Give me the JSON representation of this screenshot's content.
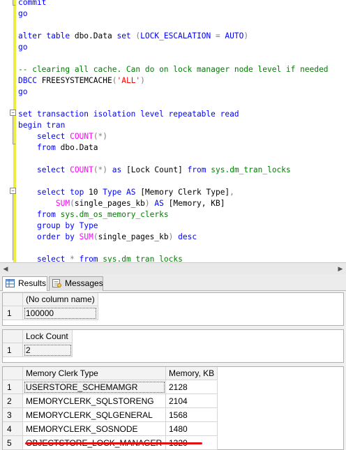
{
  "editor": {
    "lines": [
      {
        "tokens": [
          {
            "t": "commit",
            "c": "kw"
          }
        ]
      },
      {
        "tokens": [
          {
            "t": "go",
            "c": "kw"
          }
        ]
      },
      {
        "tokens": []
      },
      {
        "tokens": [
          {
            "t": "alter table",
            "c": "kw"
          },
          {
            "t": " dbo.Data ",
            "c": "obj"
          },
          {
            "t": "set",
            "c": "kw"
          },
          {
            "t": " (",
            "c": "gry"
          },
          {
            "t": "LOCK_ESCALATION",
            "c": "kw"
          },
          {
            "t": " = ",
            "c": "gry"
          },
          {
            "t": "AUTO",
            "c": "kw"
          },
          {
            "t": ")",
            "c": "gry"
          }
        ]
      },
      {
        "tokens": [
          {
            "t": "go",
            "c": "kw"
          }
        ]
      },
      {
        "tokens": []
      },
      {
        "tokens": [
          {
            "t": "-- clearing all cache. Can do on lock manager node level if needed",
            "c": "cmt"
          }
        ]
      },
      {
        "tokens": [
          {
            "t": "DBCC",
            "c": "kw"
          },
          {
            "t": " FREESYSTEMCACHE",
            "c": "obj"
          },
          {
            "t": "(",
            "c": "gry"
          },
          {
            "t": "'ALL'",
            "c": "str"
          },
          {
            "t": ")",
            "c": "gry"
          }
        ]
      },
      {
        "tokens": [
          {
            "t": "go",
            "c": "kw"
          }
        ]
      },
      {
        "tokens": []
      },
      {
        "tokens": [
          {
            "t": "set transaction isolation level repeatable read",
            "c": "kw"
          }
        ]
      },
      {
        "tokens": [
          {
            "t": "begin tran",
            "c": "kw"
          }
        ]
      },
      {
        "tokens": [
          {
            "t": "    "
          },
          {
            "t": "select",
            "c": "kw"
          },
          {
            "t": " "
          },
          {
            "t": "COUNT",
            "c": "fn"
          },
          {
            "t": "(*)",
            "c": "gry"
          }
        ]
      },
      {
        "tokens": [
          {
            "t": "    "
          },
          {
            "t": "from",
            "c": "kw"
          },
          {
            "t": " dbo.Data",
            "c": "obj"
          }
        ]
      },
      {
        "tokens": []
      },
      {
        "tokens": [
          {
            "t": "    "
          },
          {
            "t": "select",
            "c": "kw"
          },
          {
            "t": " "
          },
          {
            "t": "COUNT",
            "c": "fn"
          },
          {
            "t": "(*)",
            "c": "gry"
          },
          {
            "t": " "
          },
          {
            "t": "as",
            "c": "kw"
          },
          {
            "t": " [Lock Count] ",
            "c": "obj"
          },
          {
            "t": "from",
            "c": "kw"
          },
          {
            "t": " "
          },
          {
            "t": "sys.dm_tran_locks",
            "c": "sys"
          }
        ]
      },
      {
        "tokens": []
      },
      {
        "tokens": [
          {
            "t": "    "
          },
          {
            "t": "select top",
            "c": "kw"
          },
          {
            "t": " 10 ",
            "c": "obj"
          },
          {
            "t": "Type",
            "c": "kw"
          },
          {
            "t": " "
          },
          {
            "t": "AS",
            "c": "kw"
          },
          {
            "t": " [Memory Clerk Type]",
            "c": "obj"
          },
          {
            "t": ",",
            "c": "gry"
          }
        ]
      },
      {
        "tokens": [
          {
            "t": "        "
          },
          {
            "t": "SUM",
            "c": "fn"
          },
          {
            "t": "(",
            "c": "gry"
          },
          {
            "t": "single_pages_kb",
            "c": "obj"
          },
          {
            "t": ")",
            "c": "gry"
          },
          {
            "t": " "
          },
          {
            "t": "AS",
            "c": "kw"
          },
          {
            "t": " [Memory, KB]",
            "c": "obj"
          }
        ]
      },
      {
        "tokens": [
          {
            "t": "    "
          },
          {
            "t": "from",
            "c": "kw"
          },
          {
            "t": " "
          },
          {
            "t": "sys.dm_os_memory_clerks",
            "c": "sys"
          }
        ]
      },
      {
        "tokens": [
          {
            "t": "    "
          },
          {
            "t": "group by",
            "c": "kw"
          },
          {
            "t": " "
          },
          {
            "t": "Type",
            "c": "kw"
          }
        ]
      },
      {
        "tokens": [
          {
            "t": "    "
          },
          {
            "t": "order by",
            "c": "kw"
          },
          {
            "t": " "
          },
          {
            "t": "SUM",
            "c": "fn"
          },
          {
            "t": "(",
            "c": "gry"
          },
          {
            "t": "single_pages_kb",
            "c": "obj"
          },
          {
            "t": ")",
            "c": "gry"
          },
          {
            "t": " "
          },
          {
            "t": "desc",
            "c": "kw"
          }
        ]
      },
      {
        "tokens": []
      },
      {
        "tokens": [
          {
            "t": "    "
          },
          {
            "t": "select",
            "c": "kw"
          },
          {
            "t": " * ",
            "c": "gry"
          },
          {
            "t": "from",
            "c": "kw"
          },
          {
            "t": " "
          },
          {
            "t": "sys.dm_tran_locks",
            "c": "sys"
          }
        ]
      }
    ]
  },
  "tabs": {
    "results_label": "Results",
    "messages_label": "Messages"
  },
  "grid1": {
    "header": "(No column name)",
    "rows": [
      {
        "n": "1",
        "v": "100000"
      }
    ]
  },
  "grid2": {
    "header": "Lock Count",
    "rows": [
      {
        "n": "1",
        "v": "2"
      }
    ]
  },
  "grid3": {
    "headers": [
      "Memory Clerk Type",
      "Memory, KB"
    ],
    "rows": [
      {
        "n": "1",
        "type": "USERSTORE_SCHEMAMGR",
        "kb": "2128"
      },
      {
        "n": "2",
        "type": "MEMORYCLERK_SQLSTORENG",
        "kb": "2104"
      },
      {
        "n": "3",
        "type": "MEMORYCLERK_SQLGENERAL",
        "kb": "1568"
      },
      {
        "n": "4",
        "type": "MEMORYCLERK_SOSNODE",
        "kb": "1480"
      },
      {
        "n": "5",
        "type": "OBJECTSTORE_LOCK_MANAGER",
        "kb": "1320"
      }
    ]
  },
  "colors": {
    "keyword": "#0000ff",
    "function": "#ff00ff",
    "system": "#008000",
    "string": "#ff0000",
    "comment": "#008000",
    "underline": "#e01010"
  }
}
